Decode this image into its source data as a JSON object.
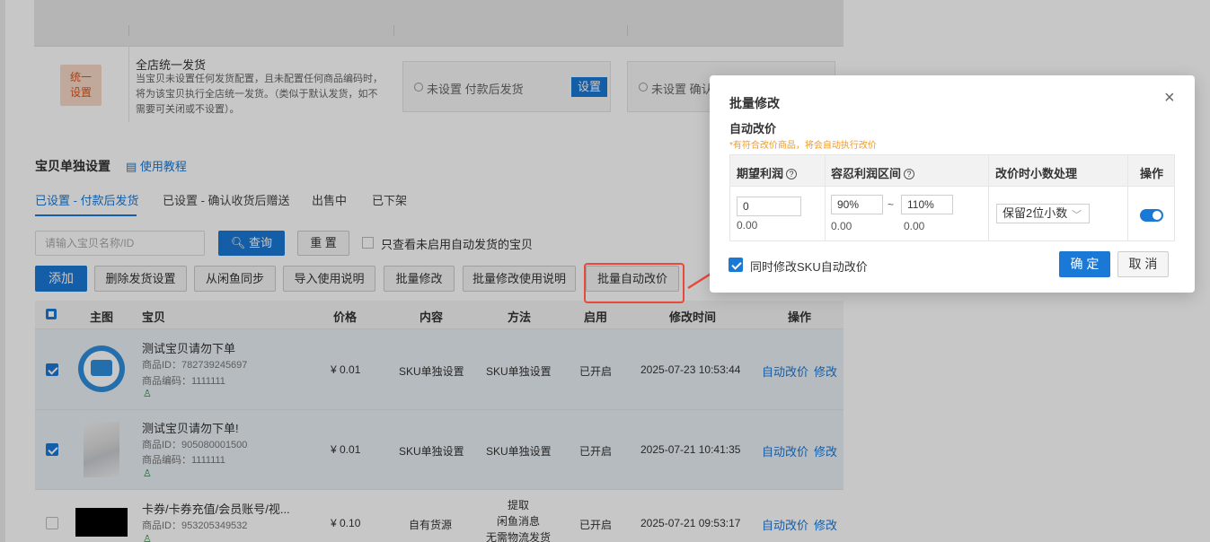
{
  "unify": {
    "badge": "统一\n设置",
    "title": "全店统一发货",
    "desc": "当宝贝未设置任何发货配置，且未配置任何商品编码时，将为该宝贝执行全店统一发货。（类似于默认发货，如不需要可关闭或不设置）。",
    "option1": "未设置 付款后发货",
    "set_label": "设置",
    "option2": "未设置 确认"
  },
  "section": {
    "title": "宝贝单独设置",
    "tutorial": "使用教程"
  },
  "tabs": [
    "已设置 - 付款后发货",
    "已设置 - 确认收货后赠送",
    "出售中",
    "已下架"
  ],
  "search": {
    "placeholder": "请输入宝贝名称/ID",
    "query_label": "查询",
    "reset_label": "重 置",
    "only_label": "只查看未启用自动发货的宝贝"
  },
  "toolbar": [
    "添加",
    "删除发货设置",
    "从闲鱼同步",
    "导入使用说明",
    "批量修改",
    "批量修改使用说明",
    "批量自动改价"
  ],
  "table": {
    "headers": [
      "主图",
      "宝贝",
      "价格",
      "内容",
      "方法",
      "启用",
      "修改时间",
      "操作"
    ],
    "rows": [
      {
        "title": "测试宝贝请勿下单",
        "id": "商品ID：782739245697",
        "code": "商品编码：1111111",
        "price": "¥ 0.01",
        "content": "SKU单独设置",
        "method": "SKU单独设置",
        "enabled": "已开启",
        "time": "2025-07-23 10:53:44",
        "op1": "自动改价",
        "op2": "修改"
      },
      {
        "title": "测试宝贝请勿下单!",
        "id": "商品ID：905080001500",
        "code": "商品编码：1111111",
        "price": "¥ 0.01",
        "content": "SKU单独设置",
        "method": "SKU单独设置",
        "enabled": "已开启",
        "time": "2025-07-21 10:41:35",
        "op1": "自动改价",
        "op2": "修改"
      },
      {
        "title": "卡券/卡券充值/会员账号/视...",
        "id": "商品ID：953205349532",
        "code": "",
        "price": "¥ 0.10",
        "content": "自有货源",
        "method": "提取\n闲鱼消息\n无需物流发货",
        "enabled": "已开启",
        "time": "2025-07-21 09:53:17",
        "op1": "自动改价",
        "op2": "修改"
      }
    ]
  },
  "modal": {
    "title": "批量修改",
    "close": "×",
    "subtitle": "自动改价",
    "hint": "*有符合改价商品，将会自动执行改价",
    "headers": [
      "期望利润",
      "容忍利润区间",
      "改价时小数处理",
      "操作"
    ],
    "expected_profit": "0",
    "expected_profit_value": "0.00",
    "range_low": "90%",
    "range_sep": "~",
    "range_high": "110%",
    "range_low_value": "0.00",
    "range_high_value": "0.00",
    "decimal_option": "保留2位小数",
    "sku_label": "同时修改SKU自动改价",
    "ok_label": "确 定",
    "cancel_label": "取 消"
  },
  "colors": {
    "accent": "#1a78d6",
    "highlight": "#e8493b",
    "hint": "#f29b26"
  }
}
